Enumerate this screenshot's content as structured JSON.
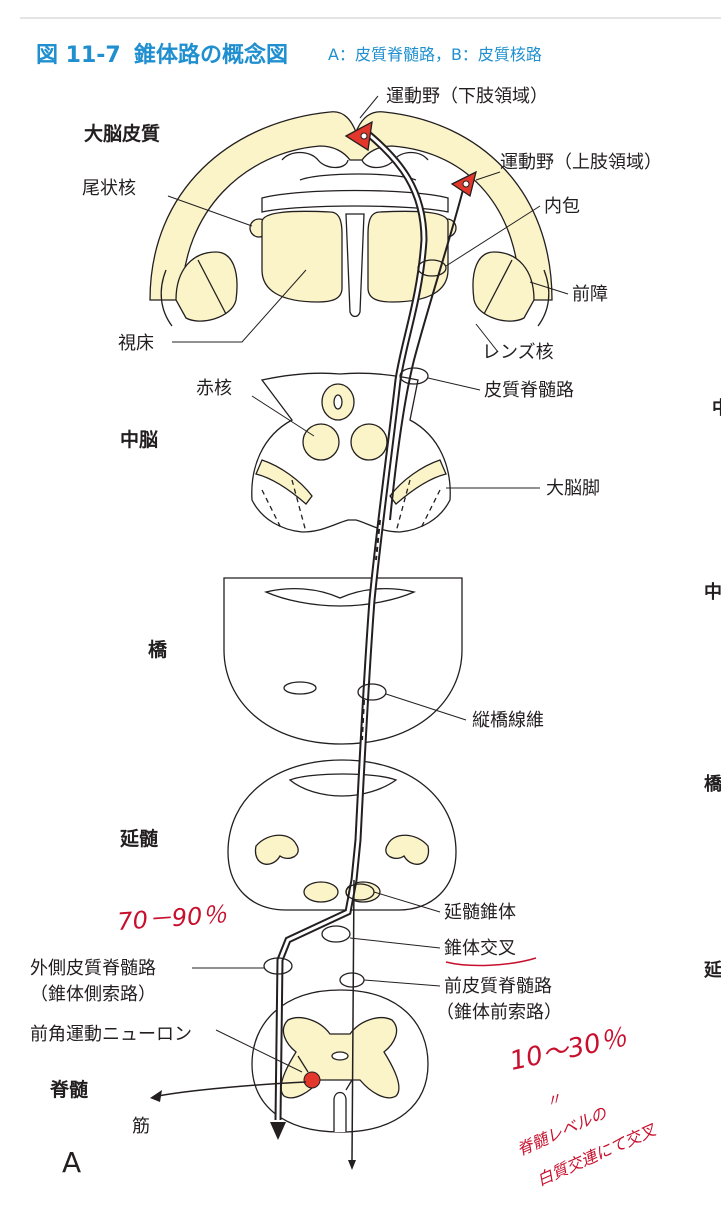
{
  "figure": {
    "number": "図 11-7",
    "title": "錐体路の概念図",
    "subtitle": "A：皮質脊髄路，B：皮質核路",
    "panel_letter": "A"
  },
  "colors": {
    "accent_blue": "#1f8fcf",
    "tissue_cream": "#fbf4c9",
    "neuron_red": "#e3372b",
    "annotation_red": "#c8102e",
    "stroke": "#231f20"
  },
  "levels": {
    "cortex": "大脳皮質",
    "midbrain": "中脳",
    "pons": "橋",
    "medulla": "延髄",
    "spinal_cord": "脊髄"
  },
  "labels": {
    "motor_area_lower": "運動野（下肢領域）",
    "motor_area_upper": "運動野（上肢領域）",
    "caudate": "尾状核",
    "internal_capsule": "内包",
    "claustrum": "前障",
    "thalamus": "視床",
    "lentiform": "レンズ核",
    "red_nucleus": "赤核",
    "corticospinal_tract": "皮質脊髄路",
    "cerebral_peduncle": "大脳脚",
    "longitudinal_pontine": "縦橋線維",
    "medullary_pyramid": "延髄錐体",
    "pyramidal_decussation": "錐体交叉",
    "lateral_cst_1": "外側皮質脊髄路",
    "lateral_cst_2": "（錐体側索路）",
    "anterior_cst_1": "前皮質脊髄路",
    "anterior_cst_2": "（錐体前索路）",
    "anterior_horn": "前角運動ニューロン",
    "muscle": "筋"
  },
  "handwritten": {
    "crossed_percent": "70－90％",
    "uncrossed_percent": "10～30％",
    "note_line1": "〃",
    "note_line2": "脊髄レベルの",
    "note_line3": "白質交連にて交叉"
  },
  "right_edge_fragments": {
    "f1": "中",
    "f2": "中",
    "f3": "橋",
    "f4": "延"
  }
}
